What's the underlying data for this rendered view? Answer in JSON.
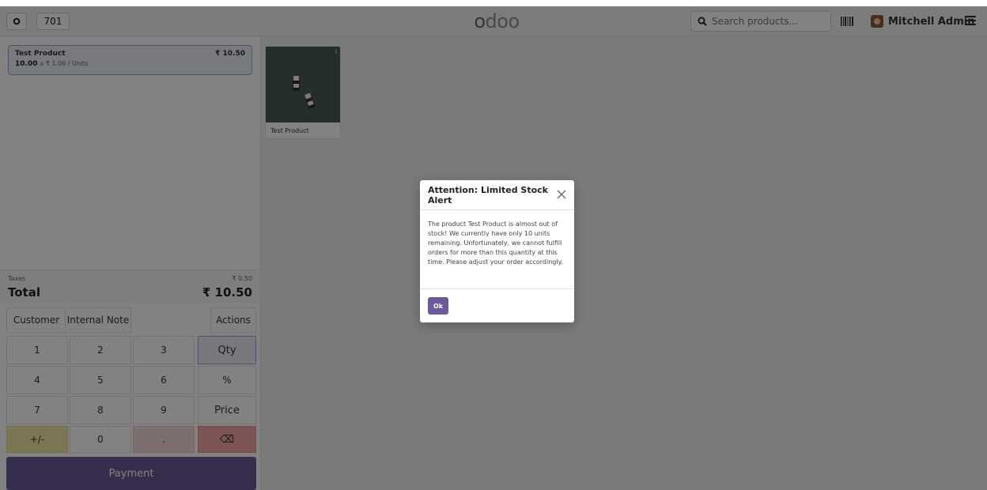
{
  "navbar": {
    "reload_icon": "circle-reload-icon",
    "table_number": "701",
    "logo_text": "odoo",
    "logo_colors": [
      "#7b5a83",
      "#8f8f8f",
      "#8f8f8f",
      "#8f8f8f"
    ],
    "search_placeholder": "Search products...",
    "user_name": "Mitchell Admin"
  },
  "order": {
    "lines": [
      {
        "product": "Test Product",
        "price": "₹ 10.50",
        "quantity": "10.00",
        "unit_info": "x ₹ 1.06 / Units"
      }
    ],
    "taxes_label": "Taxes",
    "taxes_value": "₹ 0.50",
    "total_label": "Total",
    "total_value": "₹ 10.50"
  },
  "controls": {
    "customer": "Customer",
    "internal_note": "Internal Note",
    "actions": "Actions"
  },
  "numpad": {
    "keys": [
      [
        "1",
        "2",
        "3",
        "Qty"
      ],
      [
        "4",
        "5",
        "6",
        "%"
      ],
      [
        "7",
        "8",
        "9",
        "Price"
      ],
      [
        "+/-",
        "0",
        ".",
        "⌫"
      ]
    ]
  },
  "payment_label": "Payment",
  "products": [
    {
      "name": "Test Product",
      "info": "i"
    }
  ],
  "dialog": {
    "title": "Attention: Limited Stock Alert",
    "body": "The product Test Product is almost out of stock! We currently have only 10 units remaining. Unfortunately, we cannot fulfill orders for more than this quantity at this time. Please adjust your order accordingly.",
    "ok_label": "Ok"
  },
  "colors": {
    "primary": "#6d5a98",
    "plus_minus": "#f6e7a6",
    "decimal": "#f6d9d9",
    "backspace": "#f4a6a6",
    "qty_active": "#eceefa"
  }
}
